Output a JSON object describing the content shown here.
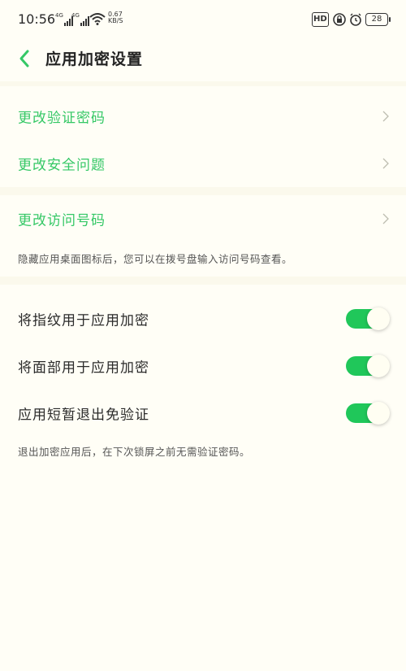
{
  "status_bar": {
    "time": "10:56",
    "sim1_label": "4G",
    "sim2_label": "4G",
    "speed_value": "0.67",
    "speed_unit": "KB/S",
    "hd_label": "HD",
    "battery": "28"
  },
  "header": {
    "title": "应用加密设置",
    "back_icon": "chevron-left-icon"
  },
  "password_section": {
    "items": [
      {
        "label": "更改验证密码"
      },
      {
        "label": "更改安全问题"
      }
    ]
  },
  "access_section": {
    "item_label": "更改访问号码",
    "note": "隐藏应用桌面图标后，您可以在拨号盘输入访问号码查看。"
  },
  "toggle_section": {
    "items": [
      {
        "label": "将指纹用于应用加密",
        "enabled": true
      },
      {
        "label": "将面部用于应用加密",
        "enabled": true
      },
      {
        "label": "应用短暂退出免验证",
        "enabled": true
      }
    ],
    "note": "退出加密应用后，在下次锁屏之前无需验证密码。"
  },
  "colors": {
    "accent_green": "#35c866",
    "toggle_on": "#20c75a",
    "background": "#fffef6"
  }
}
